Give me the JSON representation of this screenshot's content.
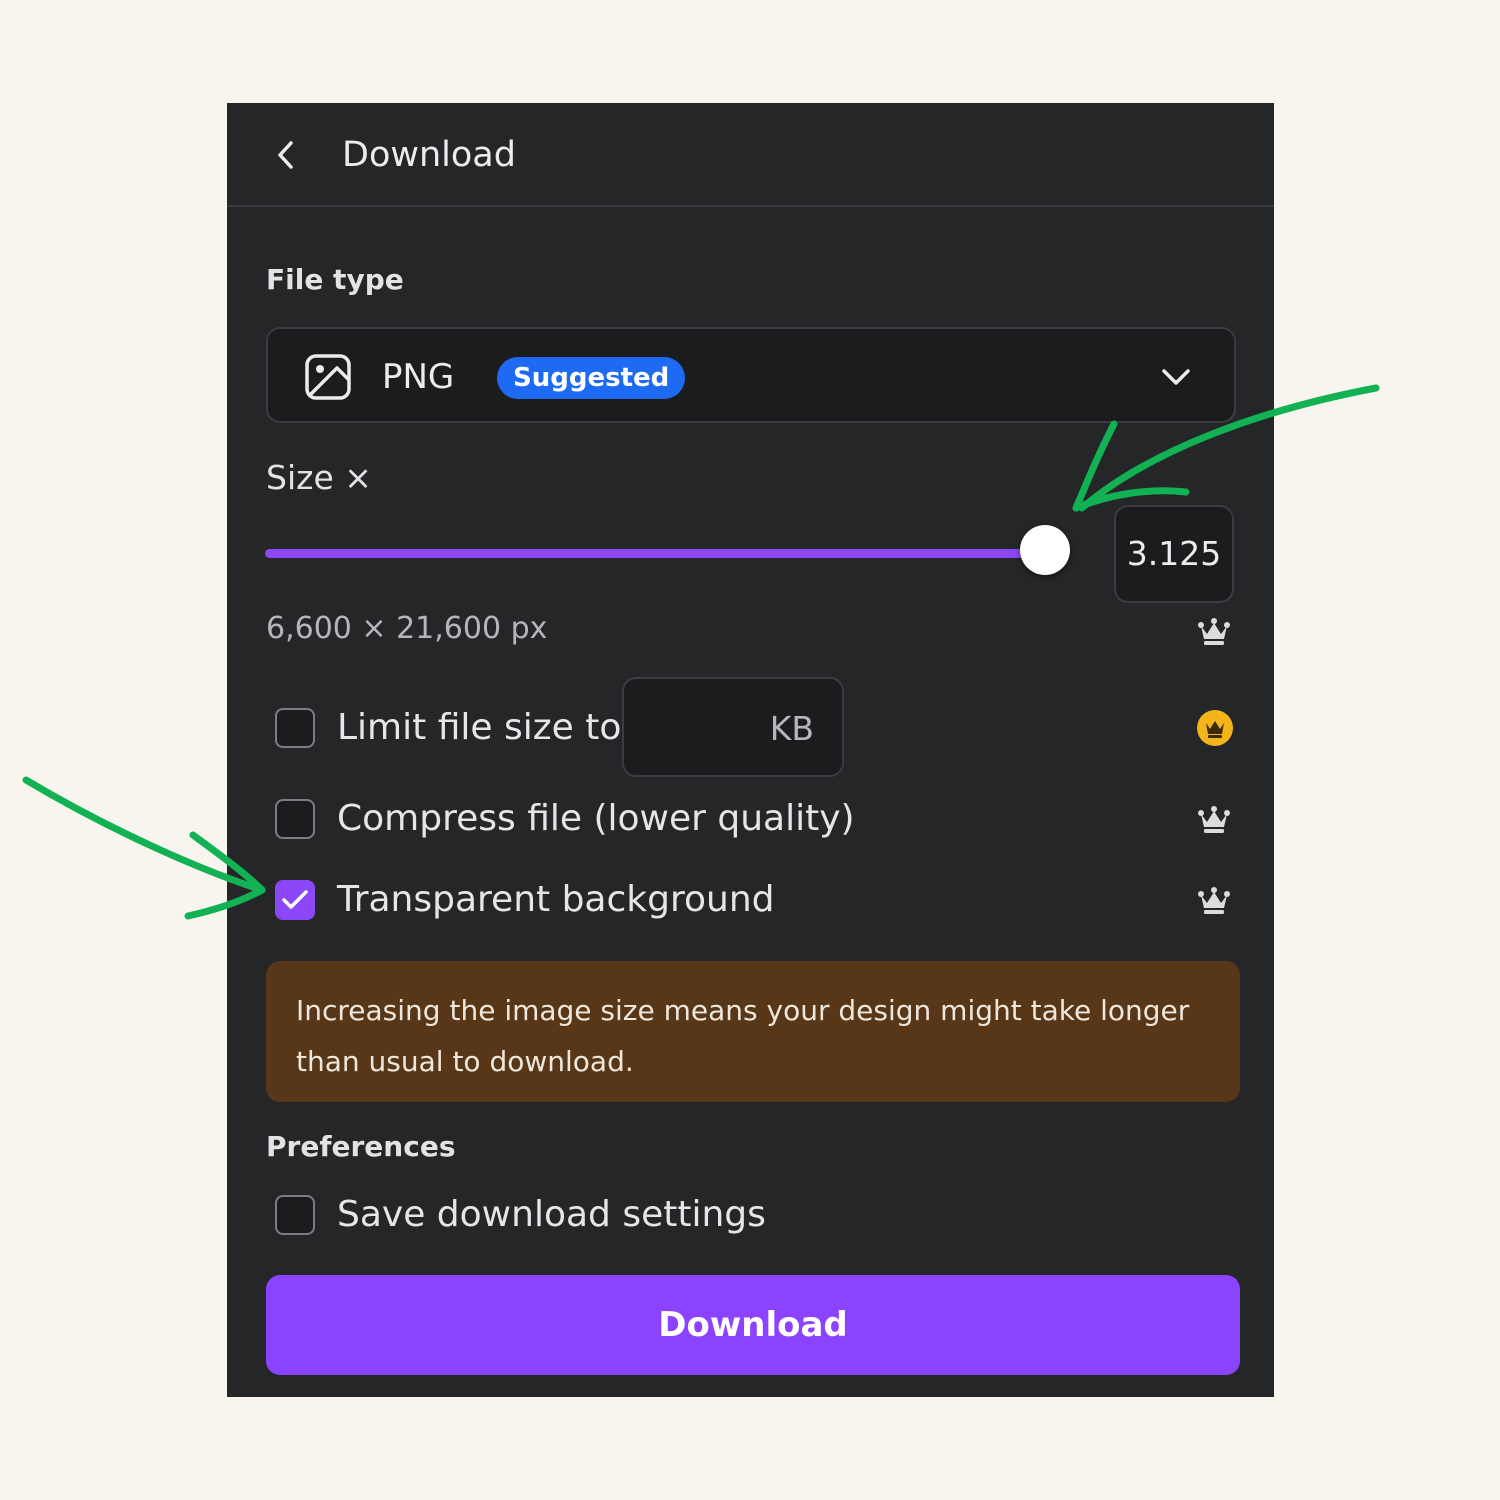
{
  "header": {
    "title": "Download",
    "back_icon": "chevron-left-icon"
  },
  "file_type": {
    "label": "File type",
    "selected": "PNG",
    "badge": "Suggested",
    "icon": "image-icon",
    "dropdown_icon": "chevron-down-icon"
  },
  "size": {
    "label": "Size ×",
    "value": "3.125",
    "slider_fraction": 1.0,
    "dimensions": "6,600 × 21,600 px"
  },
  "options": {
    "limit_file_size": {
      "label": "Limit file size to",
      "unit": "KB",
      "checked": false
    },
    "compress": {
      "label": "Compress file (lower quality)",
      "checked": false
    },
    "transparent": {
      "label": "Transparent background",
      "checked": true
    }
  },
  "notice": "Increasing the image size means your design might take longer than usual to download.",
  "preferences": {
    "label": "Preferences",
    "save_settings": {
      "label": "Save download settings",
      "checked": false
    }
  },
  "download_button": "Download",
  "colors": {
    "accent": "#8c43ff",
    "badge_blue": "#1f6af3",
    "notice_bg": "#573718",
    "panel_bg": "#252628",
    "premium_gold": "#f3b51a",
    "annotation_arrow": "#12b154"
  },
  "icons": [
    "crown-icon",
    "check-icon",
    "annotation-arrow"
  ]
}
